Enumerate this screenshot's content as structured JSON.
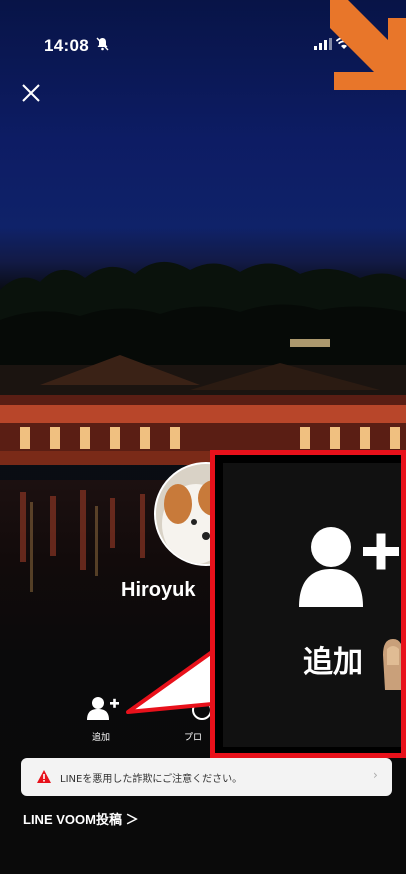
{
  "status_bar": {
    "time": "14:08"
  },
  "profile": {
    "name": "Hiroyuk"
  },
  "actions": {
    "add_label": "追加",
    "profile_label": "プロ"
  },
  "warning": {
    "text": "LINEを悪用した詐欺にご注意ください。"
  },
  "voom_link": "LINE VOOM投稿",
  "zoom_callout": {
    "label": "追加"
  },
  "colors": {
    "accent_red": "#e8111b",
    "arrow_orange": "#e8762a",
    "warning_red": "#e8111b"
  },
  "icons": [
    "bell-icon",
    "signal-icon",
    "wifi-icon",
    "battery-icon",
    "close-icon",
    "add-friend-icon",
    "chevron-right-icon",
    "warning-icon"
  ]
}
